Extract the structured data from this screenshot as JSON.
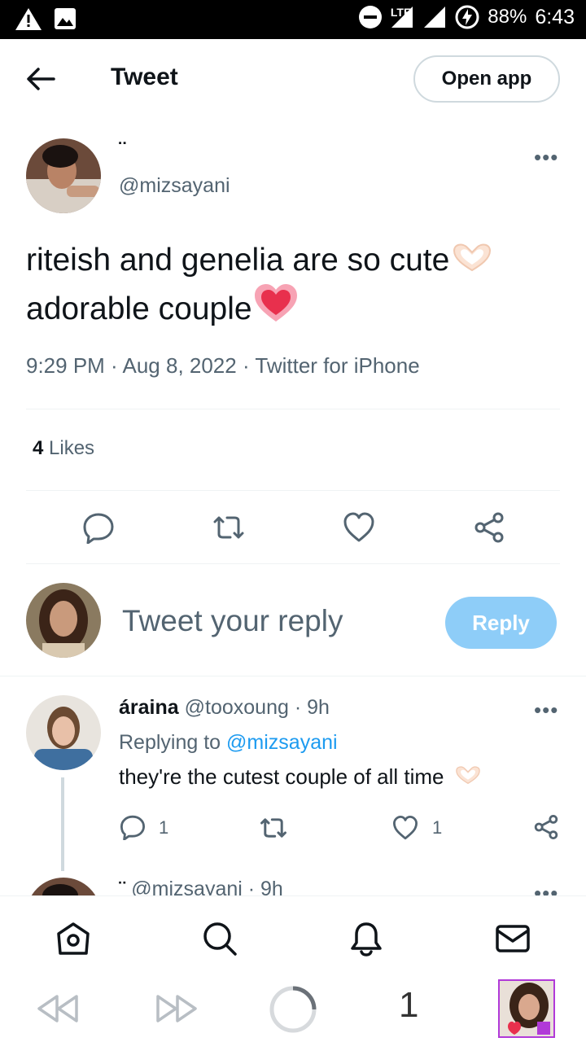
{
  "status_bar": {
    "network": "LTE",
    "battery": "88%",
    "time": "6:43"
  },
  "header": {
    "title": "Tweet",
    "open_app_label": "Open app"
  },
  "tweet": {
    "display_name": "¨",
    "handle": "@mizsayani",
    "text_line1": "riteish and genelia are so cute",
    "text_line2": "adorable couple",
    "meta": "9:29 PM · Aug 8, 2022 · Twitter for iPhone",
    "likes_count": "4",
    "likes_label": "Likes"
  },
  "composer": {
    "placeholder": "Tweet your reply",
    "reply_button": "Reply"
  },
  "reply": {
    "display_name": "áraina",
    "handle_time": "@tooxoung · 9h",
    "replying_to_label": "Replying to",
    "replying_to_handle": "@mizsayani",
    "text": "they're the cutest couple of all time",
    "reply_count": "1",
    "like_count": "1"
  },
  "next_reply": {
    "display_name": "¨",
    "handle_time": "@mizsayani · 9h"
  },
  "browser_bar": {
    "tab_count": "1"
  },
  "colors": {
    "accent": "#1d9bf0",
    "reply_button_disabled": "#8ecdf8",
    "secondary_text": "#536471"
  }
}
